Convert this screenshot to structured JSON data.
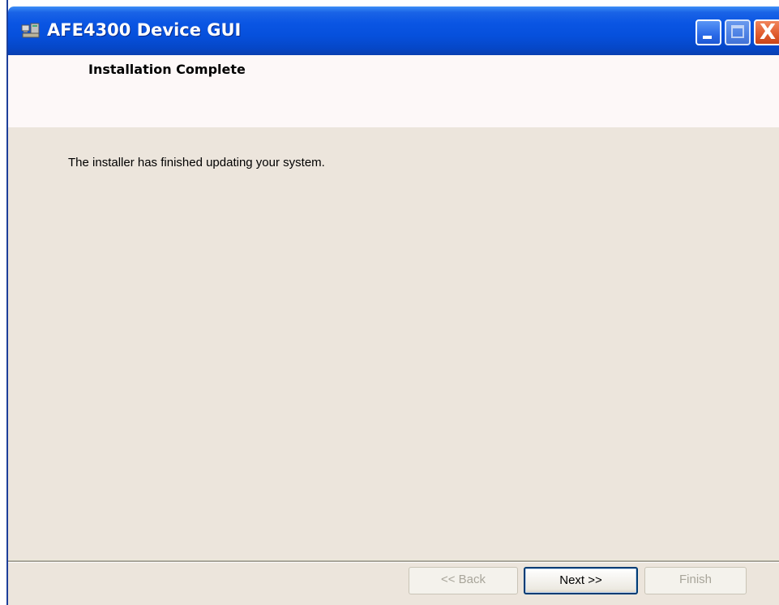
{
  "window": {
    "title": "AFE4300 Device GUI",
    "icon": "app-icon",
    "controls": {
      "minimize_icon": "minimize-icon",
      "maximize_icon": "maximize-icon",
      "close_icon": "close-icon",
      "close_glyph": "X"
    },
    "titlebar_color": "#0650dc"
  },
  "banner": {
    "title": "Installation Complete"
  },
  "main": {
    "message": "The installer has finished updating your system."
  },
  "footer": {
    "back_label": "<< Back",
    "next_label": "Next >>",
    "finish_label": "Finish",
    "back_enabled": false,
    "next_enabled": true,
    "finish_enabled": false
  }
}
